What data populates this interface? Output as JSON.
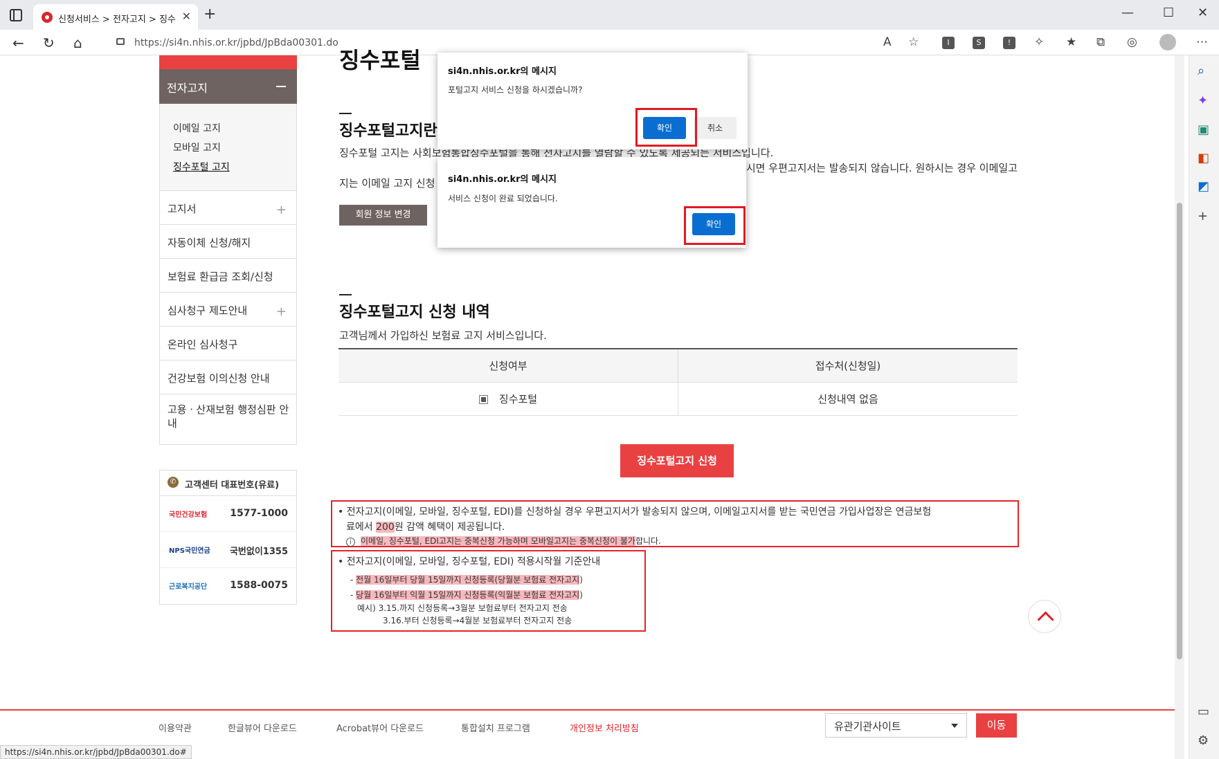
{
  "browser": {
    "tab_title": "신청서비스 > 전자고지 > 징수포",
    "url": "https://si4n.nhis.or.kr/jpbd/JpBda00301.do",
    "status_url": "https://si4n.nhis.or.kr/jpbd/JpBda00301.do#"
  },
  "sidebar": {
    "active": "전자고지",
    "sub_items": [
      "이메일 고지",
      "모바일 고지",
      "징수포털 고지"
    ],
    "items": [
      {
        "label": "고지서",
        "expand": true
      },
      {
        "label": "자동이체 신청/해지",
        "expand": false
      },
      {
        "label": "보험료 환급금 조회/신청",
        "expand": false
      },
      {
        "label": "심사청구 제도안내",
        "expand": true
      },
      {
        "label": "온라인 심사청구",
        "expand": false
      },
      {
        "label": "건강보험 이의신청 안내",
        "expand": false
      },
      {
        "label": "고용ㆍ산재보험 행정심판 안내",
        "expand": false
      }
    ],
    "call_center": {
      "title": "고객센터 대표번호(유료)",
      "rows": [
        {
          "org": "국민건강보험",
          "number": "1577-1000"
        },
        {
          "org": "NPS국민연금",
          "number": "국번없이1355"
        },
        {
          "org": "근로복지공단",
          "number": "1588-0075"
        }
      ]
    }
  },
  "main": {
    "heading_partial": "징수포털",
    "section1_title": "징수포털고지란",
    "section1_line1": "징수포털 고지는 사회보험통합징수포털을 통해 전자고지를 열람할 수 있도록 제공되는 서비스입니다.",
    "section1_line2": "징수포털 고지를 신청하시면 우편고지서는 발송되지 않습니다. 원하시는 경우 이메일고",
    "section1_line3": "지는 이메일 고지 신청",
    "member_button": "회원 정보 변경",
    "section2_title": "징수포털고지 신청 내역",
    "section2_desc": "고객님께서 가입하신 보험료 고지 서비스입니다.",
    "table": {
      "headers": [
        "신청여부",
        "접수처(신청일)"
      ],
      "row": {
        "service": "징수포털",
        "status": "신청내역 없음"
      }
    },
    "apply_button": "징수포털고지 신청",
    "notice1_line1": "• 전자고지(이메일, 모바일, 징수포털, EDI)를 신청하실 경우 우편고지서가 발송되지 않으며, 이메일고지서를 받는 국민연금 가입사업장은 연금보험",
    "notice1_line2_pre": "료에서 ",
    "notice1_line2_hl": "200",
    "notice1_line2_post": "원 감액 혜택이 제공됩니다.",
    "notice1_info_hl": "이메일, 징수포털, EDI고지는 중복신청 가능하며 모바일고지는 중복신청이 불가",
    "notice1_info_post": "합니다.",
    "notice2_title": "• 전자고지(이메일, 모바일, 징수포털, EDI) 적용시작월 기준안내",
    "notice2_l1_hl": "전월 16일부터 당월 15일까지 신청등록(당월분 보험료 전자고지",
    "notice2_l2_hl": "당월 16일부터 익월 15일까지 신청등록(익월분 보험료 전자고지",
    "notice2_ex1": "예시) 3.15.까지 신청등록→3월분 보험료부터 전자고지 전송",
    "notice2_ex2": "3.16.부터 신청등록→4월분 보험료부터 전자고지 전송"
  },
  "footer": {
    "links": [
      "이용약관",
      "한글뷰어 다운로드",
      "Acrobat뷰어 다운로드",
      "통합설치 프로그램",
      "개인정보 처리방침"
    ],
    "select_value": "유관기관사이트",
    "move_button": "이동"
  },
  "dialog1": {
    "title": "si4n.nhis.or.kr의 메시지",
    "message": "포털고지 서비스 신청을 하시겠습니까?",
    "ok": "확인",
    "cancel": "취소"
  },
  "dialog2": {
    "title": "si4n.nhis.or.kr의 메시지",
    "message": "서비스 신청이 완료 되었습니다.",
    "ok": "확인"
  },
  "colors": {
    "accent_red": "#e94142",
    "dialog_blue": "#0a6ed1",
    "highlight_frame": "#e01a22"
  }
}
